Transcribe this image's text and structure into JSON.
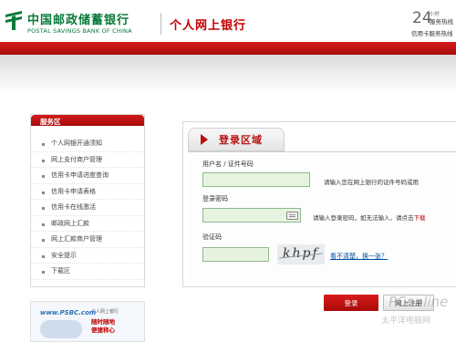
{
  "header": {
    "bank_name_cn": "中国邮政储蓄银行",
    "bank_name_en": "POSTAL SAVINGS BANK OF CHINA",
    "section_title": "个人网上银行",
    "hotline_number": "24",
    "hotline_hours": "小时",
    "hotline_label": "服务热线",
    "hotline_sub": "信用卡服务热线"
  },
  "sidebar": {
    "title": "服务区",
    "items": [
      {
        "label": "个人网银开通须知"
      },
      {
        "label": "网上支付商户管理"
      },
      {
        "label": "信用卡申请进度查询"
      },
      {
        "label": "信用卡申请表格"
      },
      {
        "label": "信用卡在线激活"
      },
      {
        "label": "邮政网上汇款"
      },
      {
        "label": "网上汇款商户管理"
      },
      {
        "label": "安全提示"
      },
      {
        "label": "下载区"
      }
    ]
  },
  "banner": {
    "url": "www.PSBC.com",
    "title": "个人网上银行",
    "line1": "随时随地",
    "line2": "便捷称心"
  },
  "login": {
    "title": "登录区域",
    "username_label": "用户名 / 证件号码",
    "username_value": "",
    "username_hint": "请输入您在网上银行的证件号码或用",
    "password_label": "登录密码",
    "password_value": "",
    "password_hint": "请输入登录密码，如无法输入，请点击",
    "password_hint_link": "下载",
    "captcha_label": "验证码",
    "captcha_value": "",
    "captcha_text": "khpf",
    "refresh_link": "看不清楚，换一张？",
    "login_button": "登录",
    "register_button": "网上注册"
  },
  "watermark": {
    "main": "PConline",
    "sub": "太平洋电脑网"
  },
  "colors": {
    "brand_red": "#c00000",
    "brand_green": "#0a7a3a",
    "input_green": "#e6f4df"
  }
}
